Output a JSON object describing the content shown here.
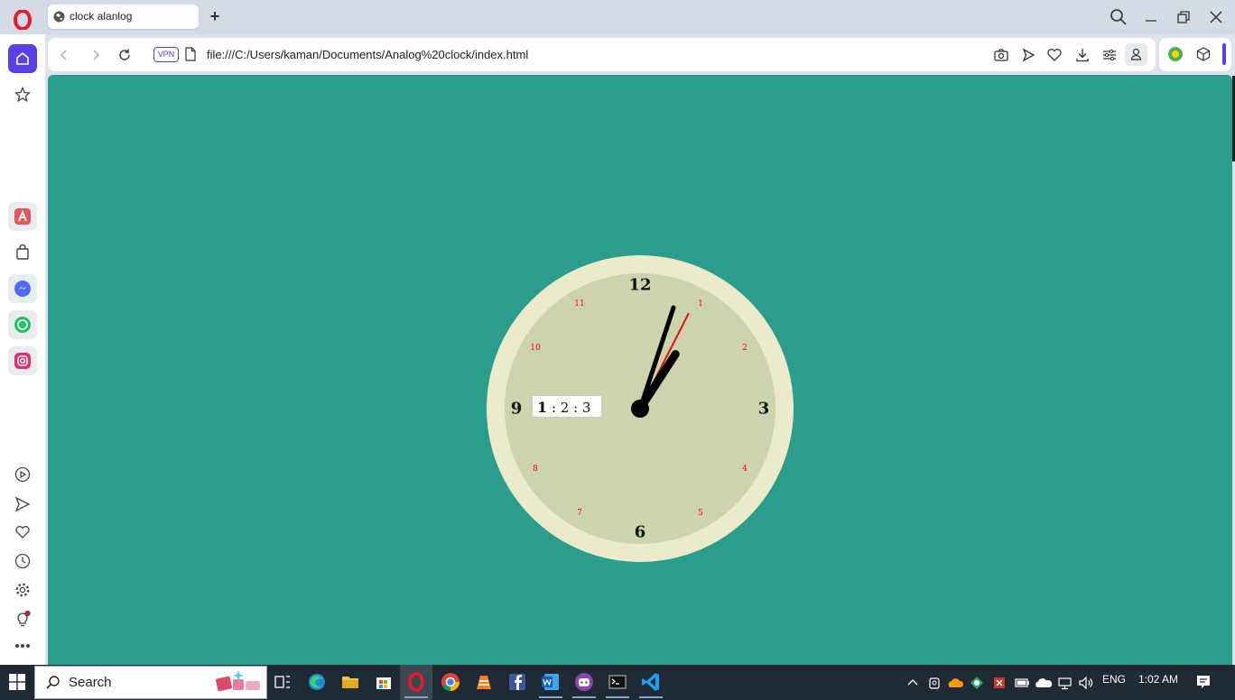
{
  "browser": {
    "tab": {
      "title": "clock alanlog"
    },
    "address_bar": {
      "vpn_label": "VPN",
      "url": "file:///C:/Users/kaman/Documents/Analog%20clock/index.html"
    },
    "accent_color": "#5a3fe6"
  },
  "page": {
    "background_color": "#2a9d8c",
    "clock": {
      "face_colors": {
        "rim": "#ebebcb",
        "face": "#ccd4ae"
      },
      "major_numerals": [
        "12",
        "3",
        "6",
        "9"
      ],
      "minor_numerals": [
        "1",
        "2",
        "4",
        "5",
        "7",
        "8",
        "10",
        "11"
      ],
      "minor_numeral_color": "#ff0000",
      "hands": {
        "hour": 1,
        "minute": 2,
        "second": 3
      },
      "digital_readout": {
        "hours": "1",
        "sep1": " : ",
        "minutes": "2",
        "sep2": " : ",
        "seconds": "3"
      }
    }
  },
  "taskbar": {
    "search_label": "Search",
    "language": "ENG",
    "time": "1:02 AM"
  }
}
